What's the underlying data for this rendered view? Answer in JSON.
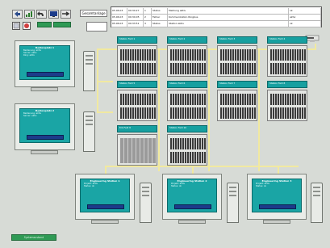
{
  "toolbar": {
    "buttons": [
      "back-icon",
      "chart-icon",
      "undo-icon",
      "monitor-icon",
      "arrow-icon"
    ],
    "label_button": "Gesamtanlage",
    "status_a": "",
    "status_b": "",
    "small_btn": ""
  },
  "events": {
    "rows": [
      {
        "date": "05.06.03",
        "time": "09:34:27",
        "id": "1",
        "type": "Status",
        "text": "Meldung aktiv",
        "state": "ok"
      },
      {
        "date": "05.06.03",
        "time": "09:34:05",
        "id": "2",
        "type": "Fehler",
        "text": "Kommunikation Ringbus",
        "state": "aktiv"
      },
      {
        "date": "05.06.03",
        "time": "09:33:51",
        "id": "3",
        "type": "Status",
        "text": "Station aktiv",
        "state": "ok"
      }
    ]
  },
  "stations": {
    "left": [
      {
        "title": "Bedienplatz 1",
        "lines": [
          "Bedienung: aktiv",
          "Server: aktiv",
          "Ring: aktiv"
        ]
      },
      {
        "title": "Bedienplatz 2",
        "lines": [
          "Bedienung: aktiv",
          "Server: aktiv"
        ]
      }
    ],
    "bottom": [
      {
        "title": "Engineering Station 1",
        "lines": [
          "Projekt: aktiv",
          "Status: ok"
        ]
      },
      {
        "title": "Engineering Station 2",
        "lines": [
          "Projekt: aktiv",
          "Status: ok"
        ]
      },
      {
        "title": "Engineering Station 3",
        "lines": [
          "Projekt: aktiv",
          "Status: ok"
        ]
      }
    ]
  },
  "units": [
    {
      "title": "Station Feld 1",
      "sub": "Status: ok"
    },
    {
      "title": "Station Feld 2",
      "sub": "Status: ok"
    },
    {
      "title": "Station Feld 3",
      "sub": "Status: ok"
    },
    {
      "title": "Station Feld 4",
      "sub": "Status: ok"
    },
    {
      "title": "Station Feld 5",
      "sub": "Status: ok"
    },
    {
      "title": "Station Feld 6",
      "sub": "Status: ok"
    },
    {
      "title": "Station Feld 7",
      "sub": "Status: ok"
    },
    {
      "title": "Station Feld 8",
      "sub": "Status: ok"
    },
    {
      "title": "E/A Feld 9",
      "sub": "Status: ok"
    },
    {
      "title": "Station Feld 10",
      "sub": "Status: ok"
    }
  ],
  "footer": {
    "status": "Systemzustand"
  },
  "colors": {
    "background": "#d7dbd6",
    "screen": "#1aa5a5",
    "bus_line": "#f1e9a0",
    "status_green": "#2f9a55"
  }
}
